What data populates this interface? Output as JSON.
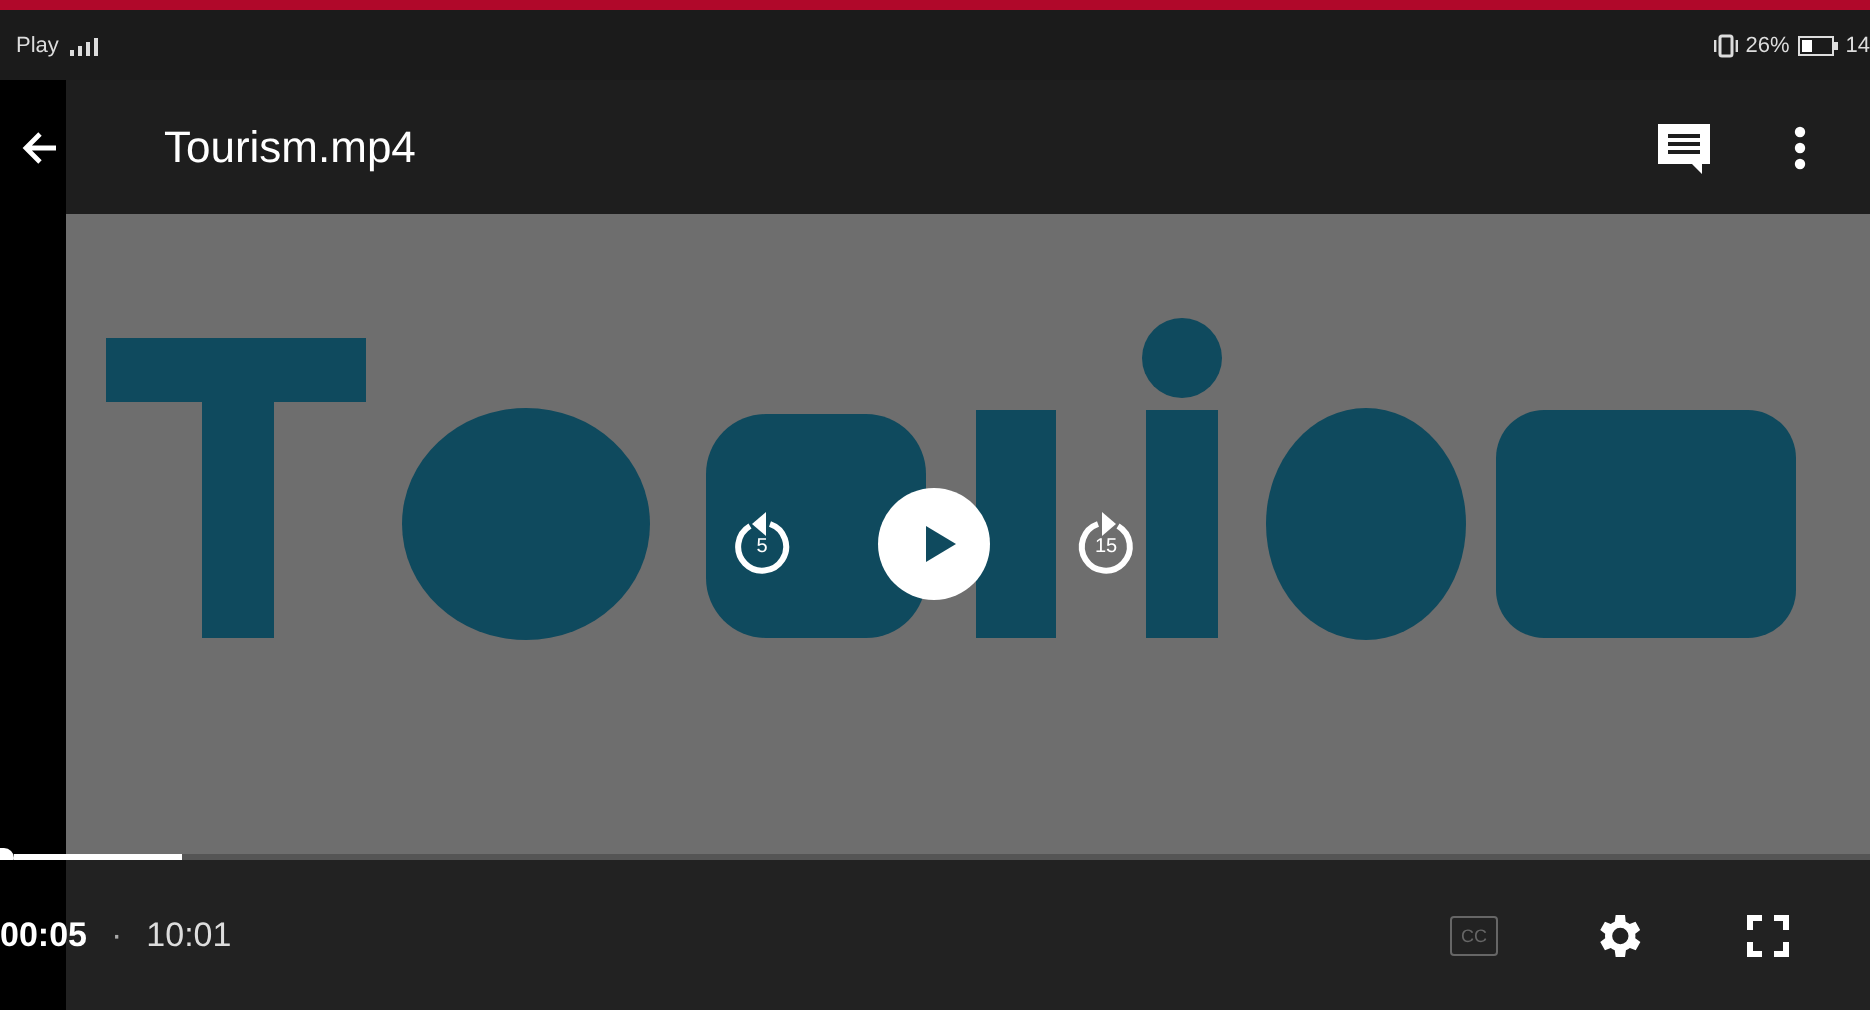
{
  "status_bar": {
    "carrier": "Play",
    "battery": "26%",
    "time": "14"
  },
  "app_bar": {
    "title": "Tourism.mp4"
  },
  "player": {
    "rewind_label": "5",
    "forward_label": "15",
    "playing": false,
    "progress": {
      "level": 0.09
    }
  },
  "bottom_bar": {
    "elapsed": "00:05",
    "separator": "·",
    "duration": "10:01",
    "cc_label": "CC",
    "captions_on": false
  }
}
